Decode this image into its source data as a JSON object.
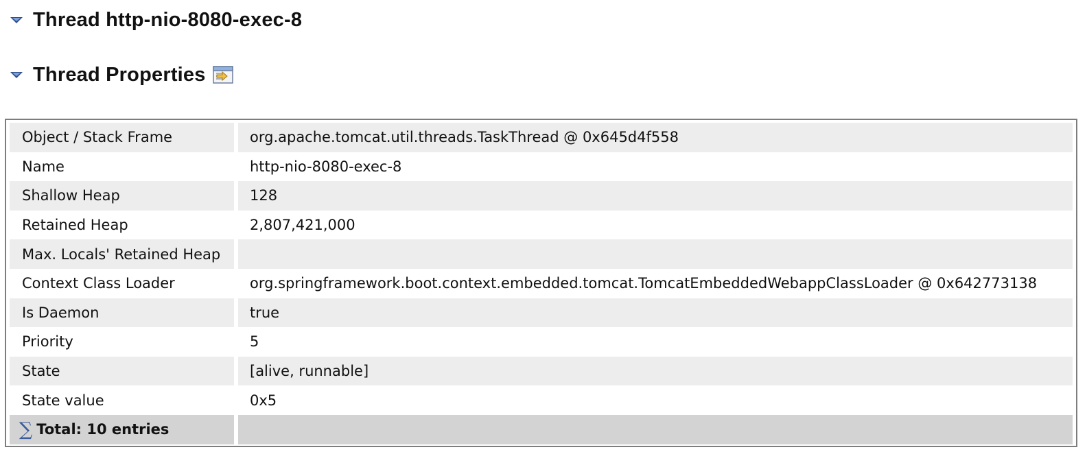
{
  "sections": [
    {
      "title": "Thread http-nio-8080-exec-8",
      "expanded": true
    },
    {
      "title": "Thread Properties",
      "expanded": true,
      "icon": "properties-icon"
    }
  ],
  "table": {
    "rows": [
      {
        "key": "Object / Stack Frame",
        "value": "org.apache.tomcat.util.threads.TaskThread @ 0x645d4f558"
      },
      {
        "key": "Name",
        "value": "http-nio-8080-exec-8"
      },
      {
        "key": "Shallow Heap",
        "value": "128"
      },
      {
        "key": "Retained Heap",
        "value": "2,807,421,000"
      },
      {
        "key": "Max. Locals' Retained Heap",
        "value": ""
      },
      {
        "key": "Context Class Loader",
        "value": "org.springframework.boot.context.embedded.tomcat.TomcatEmbeddedWebappClassLoader @ 0x642773138"
      },
      {
        "key": "Is Daemon",
        "value": "true"
      },
      {
        "key": "Priority",
        "value": "5"
      },
      {
        "key": "State",
        "value": "[alive, runnable]"
      },
      {
        "key": "State value",
        "value": "0x5"
      }
    ],
    "total": {
      "label": "Total: 10 entries",
      "icon": "sigma-icon",
      "symbol": "∑"
    }
  },
  "colors": {
    "row_alt": "#ededed",
    "row_normal": "#ffffff",
    "total_row": "#d3d3d3",
    "frame_border": "#7d7d7d",
    "twisty": "#2f4f8f"
  }
}
